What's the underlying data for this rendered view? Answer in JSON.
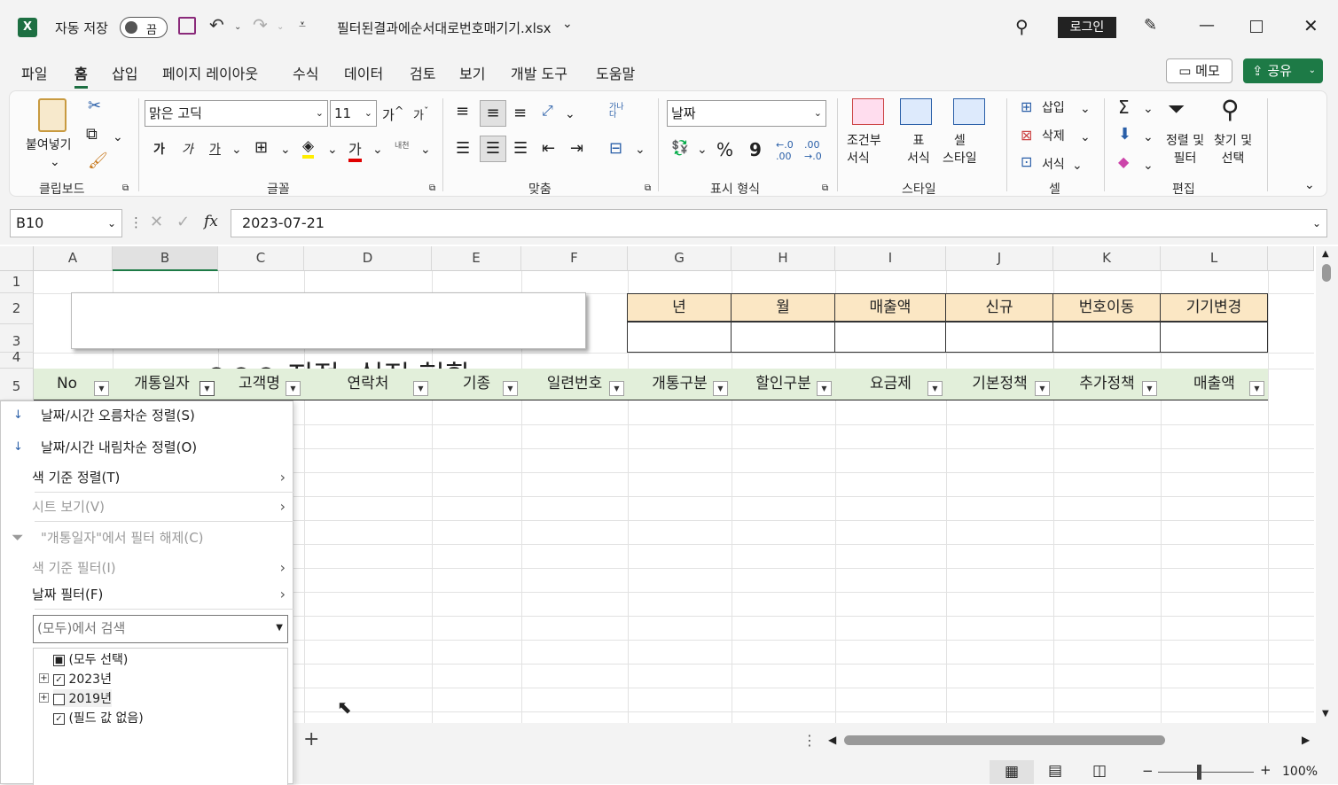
{
  "titlebar": {
    "autosave_label": "자동 저장",
    "autosave_state": "끔",
    "filename": "필터된결과에순서대로번호매기기.xlsx",
    "login": "로그인"
  },
  "tabs": [
    "파일",
    "홈",
    "삽입",
    "페이지 레이아웃",
    "수식",
    "데이터",
    "검토",
    "보기",
    "개발 도구",
    "도움말"
  ],
  "memo_label": "메모",
  "share_label": "공유",
  "ribbon": {
    "paste_label": "붙여넣기",
    "font_name": "맑은 고딕",
    "font_size": "11",
    "grow": "가",
    "shrink": "가",
    "bold": "가",
    "italic": "가",
    "underline": "가",
    "wrap": "가나\n다",
    "font_color_glyph": "가",
    "phonetic": "내천",
    "number_format": "날짜",
    "pct": "%",
    "comma": "9",
    "cond_format": "조건부\n서식",
    "table_format": "표\n서식",
    "cell_style": "셀\n스타일",
    "insert": "삽입",
    "delete": "삭제",
    "format": "서식",
    "sort_filter": "정렬 및\n필터",
    "find_select": "찾기 및\n선택",
    "groups": [
      "클립보드",
      "글꼴",
      "맞춤",
      "표시 형식",
      "스타일",
      "셀",
      "편집"
    ]
  },
  "formula": {
    "namebox": "B10",
    "value": "2023-07-21",
    "fx": "fx"
  },
  "columns": [
    "A",
    "B",
    "C",
    "D",
    "E",
    "F",
    "G",
    "H",
    "I",
    "J",
    "K",
    "L"
  ],
  "rows": [
    "1",
    "2",
    "3",
    "4",
    "5"
  ],
  "sheet_title": "○○○ 지점  실적 현황",
  "summary_headers": [
    "년",
    "월",
    "매출액",
    "신규",
    "번호이동",
    "기기변경"
  ],
  "table_headers": [
    "No",
    "개통일자",
    "고객명",
    "연락처",
    "기종",
    "일련번호",
    "개통구분",
    "할인구분",
    "요금제",
    "기본정책",
    "추가정책",
    "매출액"
  ],
  "dropdown": {
    "sort_asc": "날짜/시간 오름차순 정렬(S)",
    "sort_desc": "날짜/시간 내림차순 정렬(O)",
    "sort_color": "색 기준 정렬(T)",
    "sheet_view": "시트 보기(V)",
    "clear_filter": "\"개통일자\"에서 필터 해제(C)",
    "color_filter": "색 기준 필터(I)",
    "date_filter": "날짜 필터(F)",
    "search_placeholder": "(모두)에서 검색",
    "tree": [
      {
        "label": "(모두 선택)",
        "state": "■"
      },
      {
        "label": "2023년",
        "state": "✓"
      },
      {
        "label": "2019년",
        "state": ""
      },
      {
        "label": "(필드 값 없음)",
        "state": "✓"
      }
    ]
  },
  "status": {
    "zoom": "100%"
  }
}
